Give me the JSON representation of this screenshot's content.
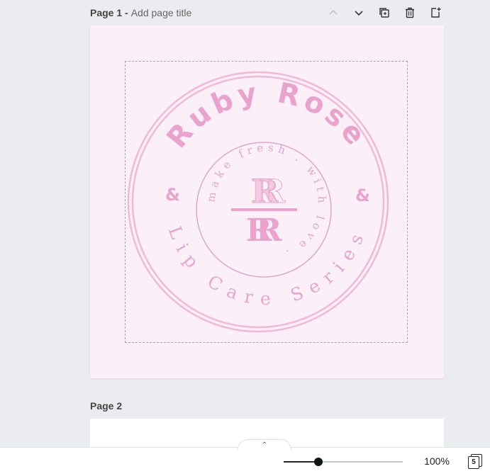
{
  "pages": [
    {
      "number_label": "Page 1 -",
      "title_placeholder": "Add page title",
      "design": {
        "brand_name": "Ruby Rose",
        "tagline": "Lip Care Series",
        "inner_text": "make fresh . with love .",
        "ampersand": "&",
        "monogram": "R",
        "colors": {
          "background": "#fcf0f8",
          "pink": "#f2b8d8",
          "deep_pink": "#eaa3cc",
          "light_pink": "#f6c9e2"
        }
      }
    },
    {
      "number_label": "Page 2"
    }
  ],
  "toolbar": {
    "move_up": "chevron-up-icon",
    "move_down": "chevron-down-icon",
    "duplicate": "duplicate-page-icon",
    "delete": "trash-icon",
    "add": "add-page-icon"
  },
  "footer": {
    "collapse_glyph": "⌃",
    "zoom_value": 100,
    "zoom_label": "100%",
    "page_count": "5"
  }
}
